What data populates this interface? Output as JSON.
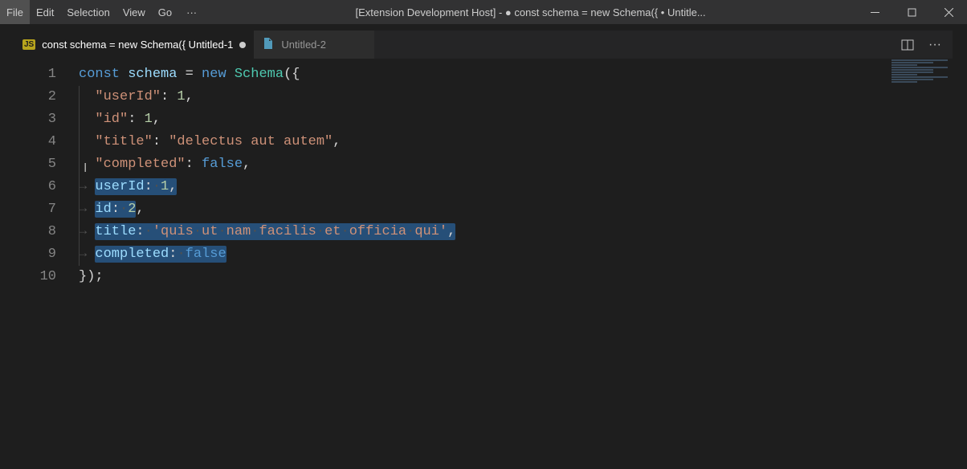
{
  "menu": {
    "items": [
      "File",
      "Edit",
      "Selection",
      "View",
      "Go"
    ],
    "ellipsis": "···"
  },
  "window": {
    "title": "[Extension Development Host] - ● const schema = new Schema({ • Untitle..."
  },
  "tabs": [
    {
      "label": "const schema = new Schema({  Untitled-1",
      "icon": "js",
      "dirty": true,
      "active": true
    },
    {
      "label": "Untitled-2",
      "icon": "file",
      "dirty": false,
      "active": false
    }
  ],
  "editor": {
    "lines": [
      {
        "n": 1,
        "tokens": [
          {
            "t": "const ",
            "c": "tk-kw"
          },
          {
            "t": "schema",
            "c": "tk-var"
          },
          {
            "t": " = ",
            "c": "tk-punc"
          },
          {
            "t": "new ",
            "c": "tk-kw"
          },
          {
            "t": "Schema",
            "c": "tk-cls"
          },
          {
            "t": "({",
            "c": "tk-punc"
          }
        ]
      },
      {
        "n": 2,
        "indent": 1,
        "tokens": [
          {
            "t": "\"userId\"",
            "c": "tk-str"
          },
          {
            "t": ": ",
            "c": "tk-punc"
          },
          {
            "t": "1",
            "c": "tk-num"
          },
          {
            "t": ",",
            "c": "tk-punc"
          }
        ]
      },
      {
        "n": 3,
        "indent": 1,
        "tokens": [
          {
            "t": "\"id\"",
            "c": "tk-str"
          },
          {
            "t": ": ",
            "c": "tk-punc"
          },
          {
            "t": "1",
            "c": "tk-num"
          },
          {
            "t": ",",
            "c": "tk-punc"
          }
        ]
      },
      {
        "n": 4,
        "indent": 1,
        "tokens": [
          {
            "t": "\"title\"",
            "c": "tk-str"
          },
          {
            "t": ": ",
            "c": "tk-punc"
          },
          {
            "t": "\"delectus aut autem\"",
            "c": "tk-str"
          },
          {
            "t": ",",
            "c": "tk-punc"
          }
        ]
      },
      {
        "n": 5,
        "indent": 1,
        "tokens": [
          {
            "t": "\"completed\"",
            "c": "tk-str"
          },
          {
            "t": ": ",
            "c": "tk-punc"
          },
          {
            "t": "false",
            "c": "tk-kw"
          },
          {
            "t": ",",
            "c": "tk-punc"
          }
        ]
      },
      {
        "n": 6,
        "indent": 1,
        "arrow": true,
        "selected": "partial",
        "tokens": [
          {
            "t": "userId",
            "c": "tk-prop",
            "sel": true
          },
          {
            "t": ":",
            "c": "tk-punc",
            "sel": true
          },
          {
            "t": "·",
            "c": "dot",
            "sel": true
          },
          {
            "t": "1",
            "c": "tk-num",
            "sel": true
          },
          {
            "t": ",",
            "c": "tk-punc",
            "sel": true
          }
        ]
      },
      {
        "n": 7,
        "indent": 1,
        "arrow": true,
        "tokens": [
          {
            "t": "id",
            "c": "tk-prop",
            "sel": true
          },
          {
            "t": ":",
            "c": "tk-punc",
            "sel": true
          },
          {
            "t": "·",
            "c": "dot",
            "sel": true
          },
          {
            "t": "2",
            "c": "tk-num",
            "sel": true
          },
          {
            "t": ",",
            "c": "tk-punc"
          }
        ]
      },
      {
        "n": 8,
        "indent": 1,
        "arrow": true,
        "tokens": [
          {
            "t": "title",
            "c": "tk-prop",
            "sel": true
          },
          {
            "t": ":",
            "c": "tk-punc",
            "sel": true
          },
          {
            "t": "·",
            "c": "dot",
            "sel": true
          },
          {
            "t": "'quis",
            "c": "tk-str",
            "sel": true
          },
          {
            "t": "·",
            "c": "dot",
            "sel": true
          },
          {
            "t": "ut",
            "c": "tk-str",
            "sel": true
          },
          {
            "t": "·",
            "c": "dot",
            "sel": true
          },
          {
            "t": "nam",
            "c": "tk-str",
            "sel": true
          },
          {
            "t": "·",
            "c": "dot",
            "sel": true
          },
          {
            "t": "facilis",
            "c": "tk-str",
            "sel": true
          },
          {
            "t": "·",
            "c": "dot",
            "sel": true
          },
          {
            "t": "et",
            "c": "tk-str",
            "sel": true
          },
          {
            "t": "·",
            "c": "dot",
            "sel": true
          },
          {
            "t": "officia",
            "c": "tk-str",
            "sel": true
          },
          {
            "t": "·",
            "c": "dot",
            "sel": true
          },
          {
            "t": "qui'",
            "c": "tk-str",
            "sel": true
          },
          {
            "t": ",",
            "c": "tk-punc",
            "sel": true
          }
        ]
      },
      {
        "n": 9,
        "indent": 1,
        "arrow": true,
        "tokens": [
          {
            "t": "completed",
            "c": "tk-prop",
            "sel": true
          },
          {
            "t": ":",
            "c": "tk-punc",
            "sel": true
          },
          {
            "t": "·",
            "c": "dot",
            "sel": true
          },
          {
            "t": "false",
            "c": "tk-kw",
            "sel": true
          }
        ]
      },
      {
        "n": 10,
        "tokens": [
          {
            "t": "});",
            "c": "tk-punc"
          }
        ]
      }
    ]
  },
  "actions": {
    "split": "split-editor",
    "more": "···"
  }
}
